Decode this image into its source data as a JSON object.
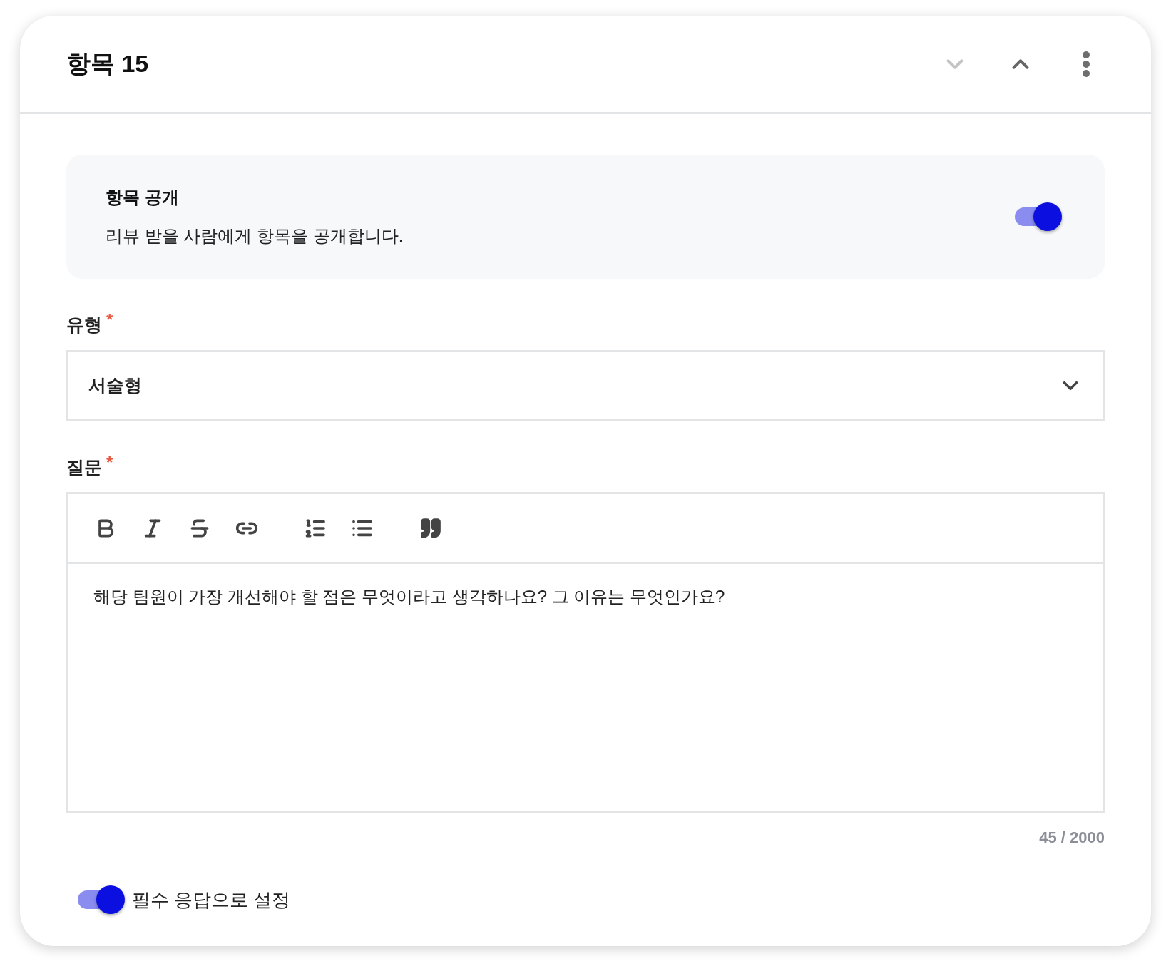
{
  "header": {
    "title": "항목 15",
    "move_down": {
      "disabled": true
    },
    "move_up": {
      "disabled": false
    }
  },
  "visibility": {
    "title": "항목 공개",
    "description": "리뷰 받을 사람에게 항목을 공개합니다.",
    "on": true
  },
  "type_field": {
    "label": "유형",
    "required_mark": "*",
    "value": "서술형"
  },
  "question_field": {
    "label": "질문",
    "required_mark": "*",
    "value": "해당 팀원이 가장 개선해야 할 점은 무엇이라고 생각하나요? 그 이유는 무엇인가요?",
    "counter": "45 / 2000"
  },
  "toolbar": [
    {
      "kind": "bold"
    },
    {
      "kind": "italic"
    },
    {
      "kind": "strike"
    },
    {
      "kind": "link"
    },
    {
      "kind": "ordered-list"
    },
    {
      "kind": "bullet-list"
    },
    {
      "kind": "quote"
    }
  ],
  "required_toggle": {
    "label": "필수 응답으로 설정",
    "on": true
  }
}
